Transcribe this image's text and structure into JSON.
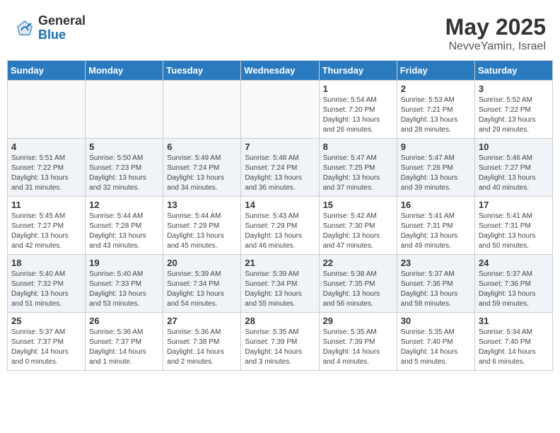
{
  "header": {
    "logo_general": "General",
    "logo_blue": "Blue",
    "month_year": "May 2025",
    "location": "NevveYamin, Israel"
  },
  "days_of_week": [
    "Sunday",
    "Monday",
    "Tuesday",
    "Wednesday",
    "Thursday",
    "Friday",
    "Saturday"
  ],
  "weeks": [
    [
      {
        "day": "",
        "info": ""
      },
      {
        "day": "",
        "info": ""
      },
      {
        "day": "",
        "info": ""
      },
      {
        "day": "",
        "info": ""
      },
      {
        "day": "1",
        "info": "Sunrise: 5:54 AM\nSunset: 7:20 PM\nDaylight: 13 hours\nand 26 minutes."
      },
      {
        "day": "2",
        "info": "Sunrise: 5:53 AM\nSunset: 7:21 PM\nDaylight: 13 hours\nand 28 minutes."
      },
      {
        "day": "3",
        "info": "Sunrise: 5:52 AM\nSunset: 7:22 PM\nDaylight: 13 hours\nand 29 minutes."
      }
    ],
    [
      {
        "day": "4",
        "info": "Sunrise: 5:51 AM\nSunset: 7:22 PM\nDaylight: 13 hours\nand 31 minutes."
      },
      {
        "day": "5",
        "info": "Sunrise: 5:50 AM\nSunset: 7:23 PM\nDaylight: 13 hours\nand 32 minutes."
      },
      {
        "day": "6",
        "info": "Sunrise: 5:49 AM\nSunset: 7:24 PM\nDaylight: 13 hours\nand 34 minutes."
      },
      {
        "day": "7",
        "info": "Sunrise: 5:48 AM\nSunset: 7:24 PM\nDaylight: 13 hours\nand 36 minutes."
      },
      {
        "day": "8",
        "info": "Sunrise: 5:47 AM\nSunset: 7:25 PM\nDaylight: 13 hours\nand 37 minutes."
      },
      {
        "day": "9",
        "info": "Sunrise: 5:47 AM\nSunset: 7:26 PM\nDaylight: 13 hours\nand 39 minutes."
      },
      {
        "day": "10",
        "info": "Sunrise: 5:46 AM\nSunset: 7:27 PM\nDaylight: 13 hours\nand 40 minutes."
      }
    ],
    [
      {
        "day": "11",
        "info": "Sunrise: 5:45 AM\nSunset: 7:27 PM\nDaylight: 13 hours\nand 42 minutes."
      },
      {
        "day": "12",
        "info": "Sunrise: 5:44 AM\nSunset: 7:28 PM\nDaylight: 13 hours\nand 43 minutes."
      },
      {
        "day": "13",
        "info": "Sunrise: 5:44 AM\nSunset: 7:29 PM\nDaylight: 13 hours\nand 45 minutes."
      },
      {
        "day": "14",
        "info": "Sunrise: 5:43 AM\nSunset: 7:29 PM\nDaylight: 13 hours\nand 46 minutes."
      },
      {
        "day": "15",
        "info": "Sunrise: 5:42 AM\nSunset: 7:30 PM\nDaylight: 13 hours\nand 47 minutes."
      },
      {
        "day": "16",
        "info": "Sunrise: 5:41 AM\nSunset: 7:31 PM\nDaylight: 13 hours\nand 49 minutes."
      },
      {
        "day": "17",
        "info": "Sunrise: 5:41 AM\nSunset: 7:31 PM\nDaylight: 13 hours\nand 50 minutes."
      }
    ],
    [
      {
        "day": "18",
        "info": "Sunrise: 5:40 AM\nSunset: 7:32 PM\nDaylight: 13 hours\nand 51 minutes."
      },
      {
        "day": "19",
        "info": "Sunrise: 5:40 AM\nSunset: 7:33 PM\nDaylight: 13 hours\nand 53 minutes."
      },
      {
        "day": "20",
        "info": "Sunrise: 5:39 AM\nSunset: 7:34 PM\nDaylight: 13 hours\nand 54 minutes."
      },
      {
        "day": "21",
        "info": "Sunrise: 5:39 AM\nSunset: 7:34 PM\nDaylight: 13 hours\nand 55 minutes."
      },
      {
        "day": "22",
        "info": "Sunrise: 5:38 AM\nSunset: 7:35 PM\nDaylight: 13 hours\nand 56 minutes."
      },
      {
        "day": "23",
        "info": "Sunrise: 5:37 AM\nSunset: 7:36 PM\nDaylight: 13 hours\nand 58 minutes."
      },
      {
        "day": "24",
        "info": "Sunrise: 5:37 AM\nSunset: 7:36 PM\nDaylight: 13 hours\nand 59 minutes."
      }
    ],
    [
      {
        "day": "25",
        "info": "Sunrise: 5:37 AM\nSunset: 7:37 PM\nDaylight: 14 hours\nand 0 minutes."
      },
      {
        "day": "26",
        "info": "Sunrise: 5:36 AM\nSunset: 7:37 PM\nDaylight: 14 hours\nand 1 minute."
      },
      {
        "day": "27",
        "info": "Sunrise: 5:36 AM\nSunset: 7:38 PM\nDaylight: 14 hours\nand 2 minutes."
      },
      {
        "day": "28",
        "info": "Sunrise: 5:35 AM\nSunset: 7:39 PM\nDaylight: 14 hours\nand 3 minutes."
      },
      {
        "day": "29",
        "info": "Sunrise: 5:35 AM\nSunset: 7:39 PM\nDaylight: 14 hours\nand 4 minutes."
      },
      {
        "day": "30",
        "info": "Sunrise: 5:35 AM\nSunset: 7:40 PM\nDaylight: 14 hours\nand 5 minutes."
      },
      {
        "day": "31",
        "info": "Sunrise: 5:34 AM\nSunset: 7:40 PM\nDaylight: 14 hours\nand 6 minutes."
      }
    ]
  ]
}
